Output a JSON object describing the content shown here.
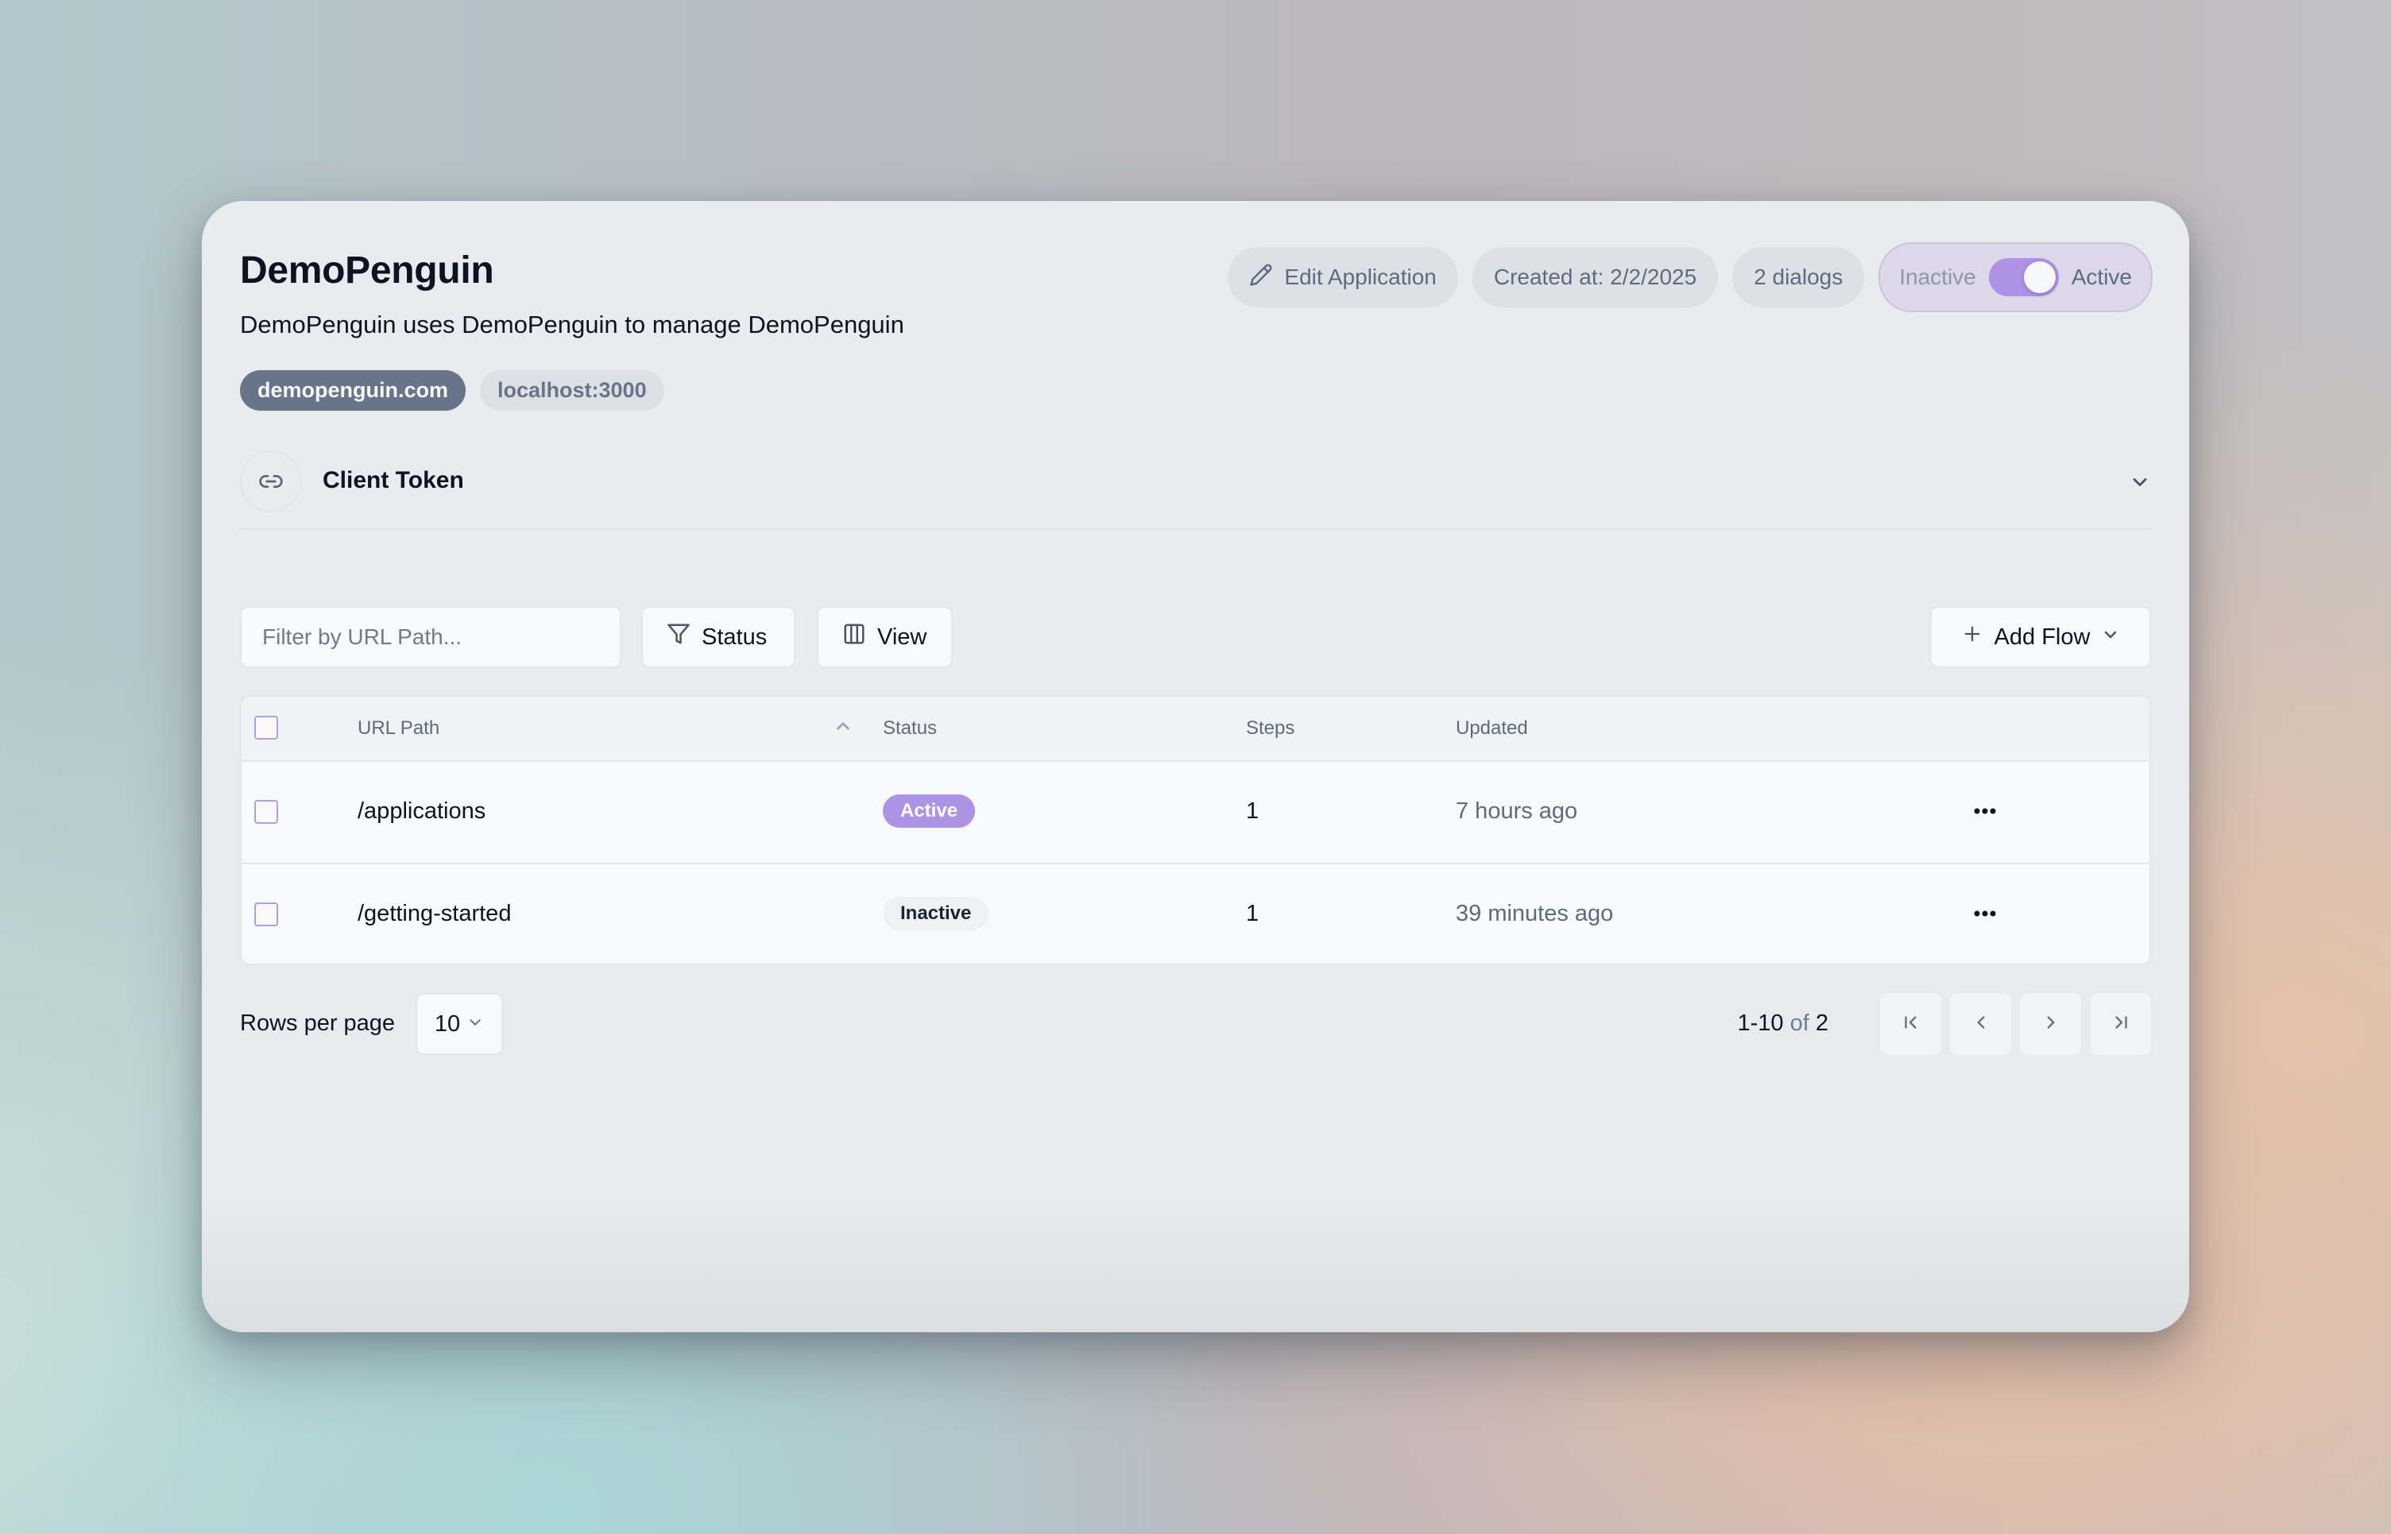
{
  "app": {
    "title": "DemoPenguin",
    "description": "DemoPenguin uses DemoPenguin to manage DemoPenguin",
    "domains": [
      {
        "label": "demopenguin.com",
        "primary": true
      },
      {
        "label": "localhost:3000",
        "primary": false
      }
    ]
  },
  "header": {
    "edit_label": "Edit Application",
    "created_label": "Created at: 2/2/2025",
    "dialogs_label": "2 dialogs",
    "toggle": {
      "off_label": "Inactive",
      "on_label": "Active",
      "checked": true
    }
  },
  "client_token": {
    "label": "Client Token",
    "icon": "link-icon",
    "expanded": false
  },
  "toolbar": {
    "filter_placeholder": "Filter by URL Path...",
    "filter_value": "",
    "status_label": "Status",
    "view_label": "View",
    "add_flow_label": "Add Flow"
  },
  "table": {
    "columns": [
      {
        "label": "URL Path",
        "sort": "ascending"
      },
      {
        "label": "Status"
      },
      {
        "label": "Steps"
      },
      {
        "label": "Updated"
      }
    ],
    "rows": [
      {
        "path": "/applications",
        "status": "Active",
        "steps": "1",
        "updated": "7 hours ago"
      },
      {
        "path": "/getting-started",
        "status": "Inactive",
        "steps": "1",
        "updated": "39 minutes ago"
      }
    ]
  },
  "pagination": {
    "rows_per_page_label": "Rows per page",
    "rows_per_page_value": "10",
    "range": "1-10",
    "of_label": "of",
    "total": "2"
  },
  "colors": {
    "accent": "#ad93e6",
    "primary_chip": "#67748a",
    "text": "#0d1321",
    "muted": "#5d6a80"
  }
}
